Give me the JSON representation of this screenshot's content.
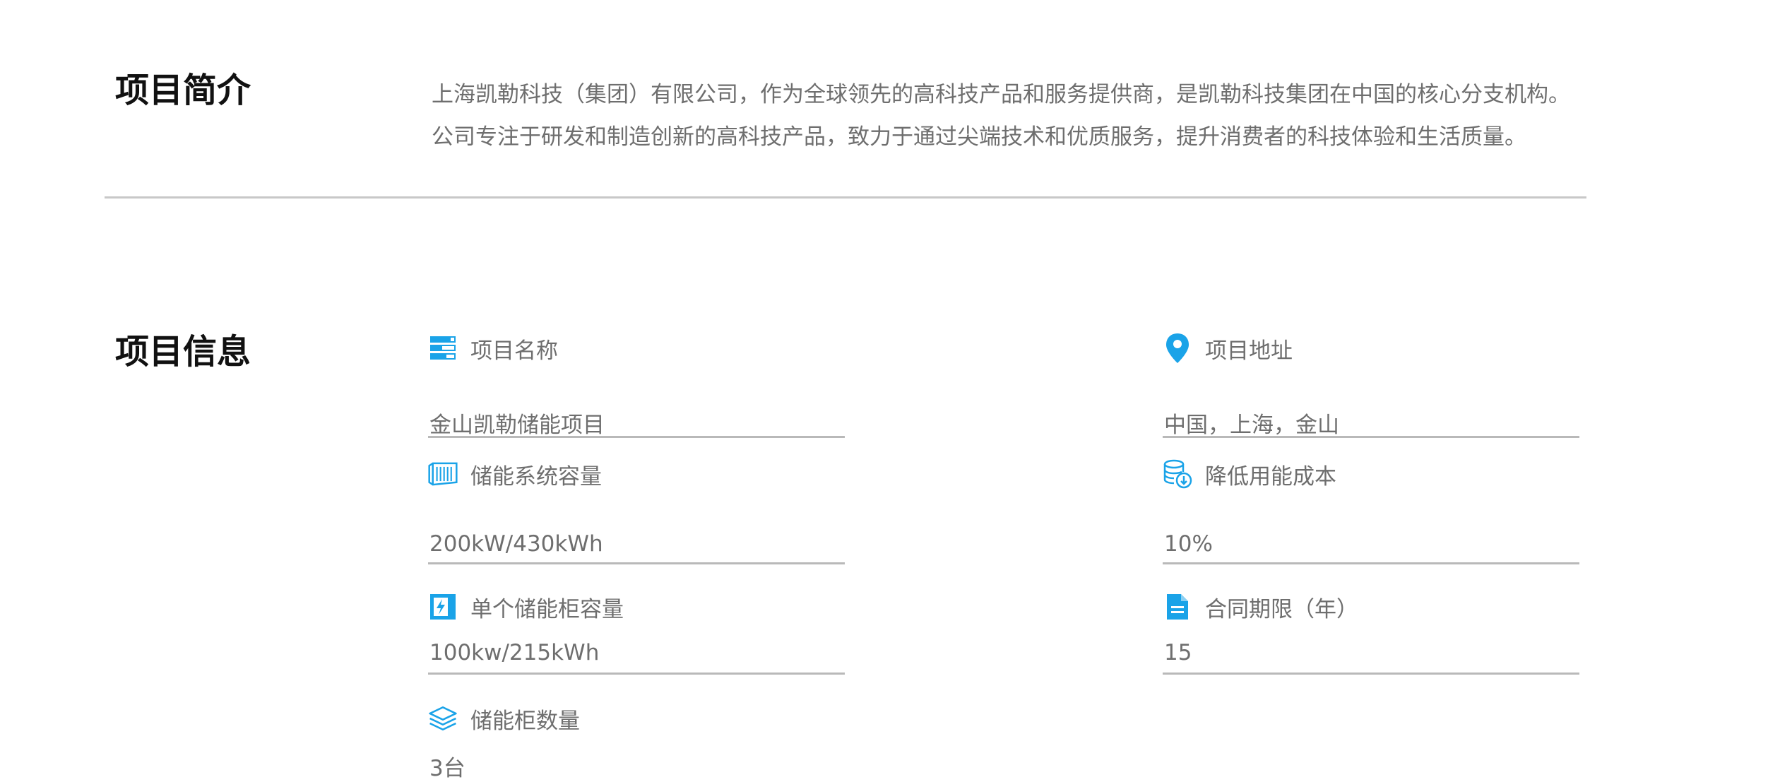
{
  "intro": {
    "title": "项目简介",
    "lines": [
      "上海凯勒科技（集团）有限公司，作为全球领先的高科技产品和服务提供商，是凯勒科技集团在中国的核心分支机构。",
      "公司专注于研发和制造创新的高科技产品，致力于通过尖端技术和优质服务，提升消费者的科技体验和生活质量。"
    ]
  },
  "info": {
    "title": "项目信息",
    "fields": {
      "name": {
        "label": "项目名称",
        "value": "金山凯勒储能项目",
        "icon": "list-icon"
      },
      "address": {
        "label": "项目地址",
        "value": "中国，上海，金山",
        "icon": "location-pin-icon"
      },
      "capacity": {
        "label": "储能系统容量",
        "value": "200kW/430kWh",
        "icon": "container-icon"
      },
      "cost": {
        "label": "降低用能成本",
        "value": "10%",
        "icon": "database-download-icon"
      },
      "cabinet": {
        "label": "单个储能柜容量",
        "value": "100kw/215kWh",
        "icon": "lightning-box-icon"
      },
      "term": {
        "label": "合同期限（年）",
        "value": "15",
        "icon": "document-icon"
      },
      "count": {
        "label": "储能柜数量",
        "value": "3台",
        "icon": "layers-icon"
      }
    }
  },
  "colors": {
    "accent": "#1aa3e8",
    "divider": "#c8c8c8",
    "text": "#6e6e6e",
    "heading": "#111111"
  }
}
